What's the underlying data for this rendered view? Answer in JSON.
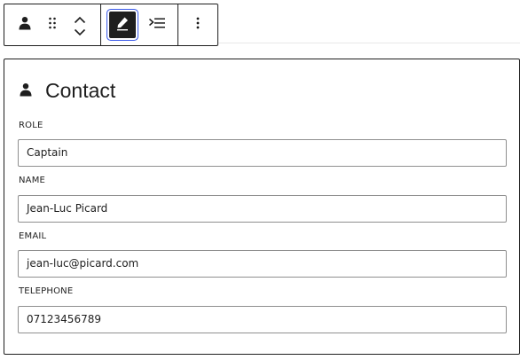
{
  "toolbar": {
    "block_icon": "person-icon",
    "drag_icon": "drag-handle-icon",
    "move_up_icon": "chevron-up-icon",
    "move_down_icon": "chevron-down-icon",
    "edit_icon": "pencil-icon",
    "outdent_icon": "outdent-icon",
    "more_icon": "more-vertical-icon"
  },
  "card": {
    "title": "Contact",
    "icon": "person-icon",
    "fields": [
      {
        "label": "ROLE",
        "value": "Captain"
      },
      {
        "label": "NAME",
        "value": "Jean-Luc Picard"
      },
      {
        "label": "EMAIL",
        "value": "jean-luc@picard.com"
      },
      {
        "label": "TELEPHONE",
        "value": "07123456789"
      }
    ]
  },
  "colors": {
    "text": "#1e1e1e",
    "focus_ring": "#3858e9",
    "input_border": "#8f8f8f"
  }
}
